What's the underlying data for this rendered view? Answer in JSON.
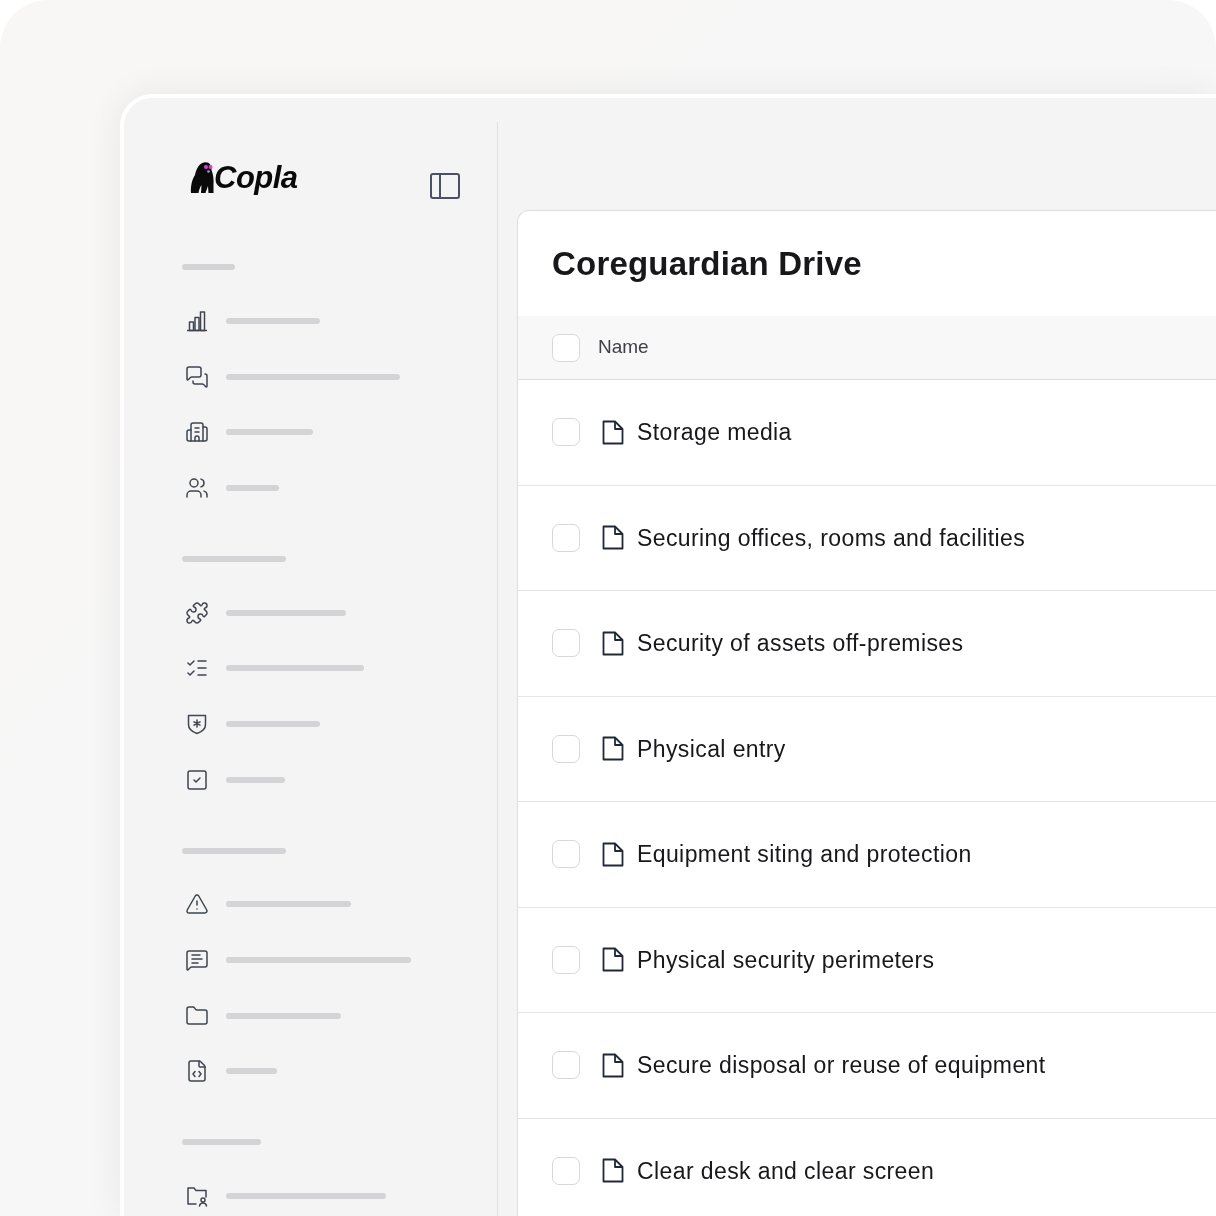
{
  "sidebar": {
    "logo": {
      "text": "Copla"
    }
  },
  "drive": {
    "title": "Coreguardian Drive",
    "select_all": {
      "checked": false
    },
    "columns": [
      "Name"
    ],
    "rows": [
      {
        "name": "Storage media",
        "checked": false
      },
      {
        "name": "Securing offices, rooms and facilities",
        "checked": false
      },
      {
        "name": "Security of assets off-premises",
        "checked": false
      },
      {
        "name": "Physical entry",
        "checked": false
      },
      {
        "name": "Equipment siting and protection",
        "checked": false
      },
      {
        "name": "Physical security perimeters",
        "checked": false
      },
      {
        "name": "Secure disposal or reuse of equipment",
        "checked": false
      },
      {
        "name": "Clear desk and clear screen",
        "checked": false
      }
    ]
  }
}
